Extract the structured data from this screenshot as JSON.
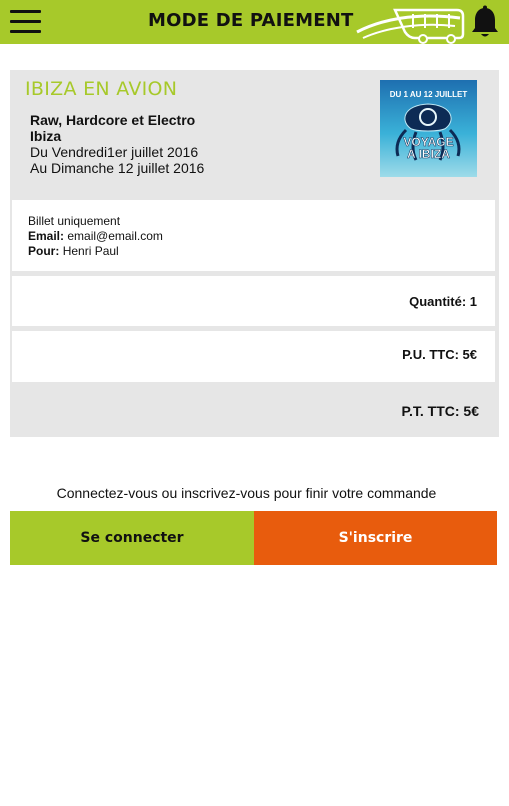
{
  "header": {
    "title": "MODE DE PAIEMENT",
    "menu_icon": "hamburger-menu-icon",
    "logo_icon": "bus-logo-icon",
    "notification_icon": "bell-icon",
    "accent_color": "#a7c92a"
  },
  "event": {
    "title": "IBIZA EN AVION",
    "subtitle": "Raw, Hardcore et Electro Ibiza",
    "date_from": "Du Vendredi1er juillet 2016",
    "date_to": "Au Dimanche 12 juillet 2016",
    "poster": {
      "top_text": "DU 1 AU 12 JUILLET",
      "main_text_1": "VOYAGE",
      "main_text_2": "A IBIZA"
    }
  },
  "ticket": {
    "type": "Billet uniquement",
    "email_label": "Email:",
    "email_value": "email@email.com",
    "for_label": "Pour:",
    "for_value": "Henri Paul"
  },
  "summary": {
    "quantity": "Quantité: 1",
    "unit_price": "P.U. TTC: 5€",
    "total_price": "P.T. TTC: 5€"
  },
  "auth": {
    "message": "Connectez-vous ou inscrivez-vous pour finir votre commande",
    "login_label": "Se connecter",
    "register_label": "S'inscrire",
    "login_color": "#a7c92a",
    "register_color": "#e85c0d"
  }
}
